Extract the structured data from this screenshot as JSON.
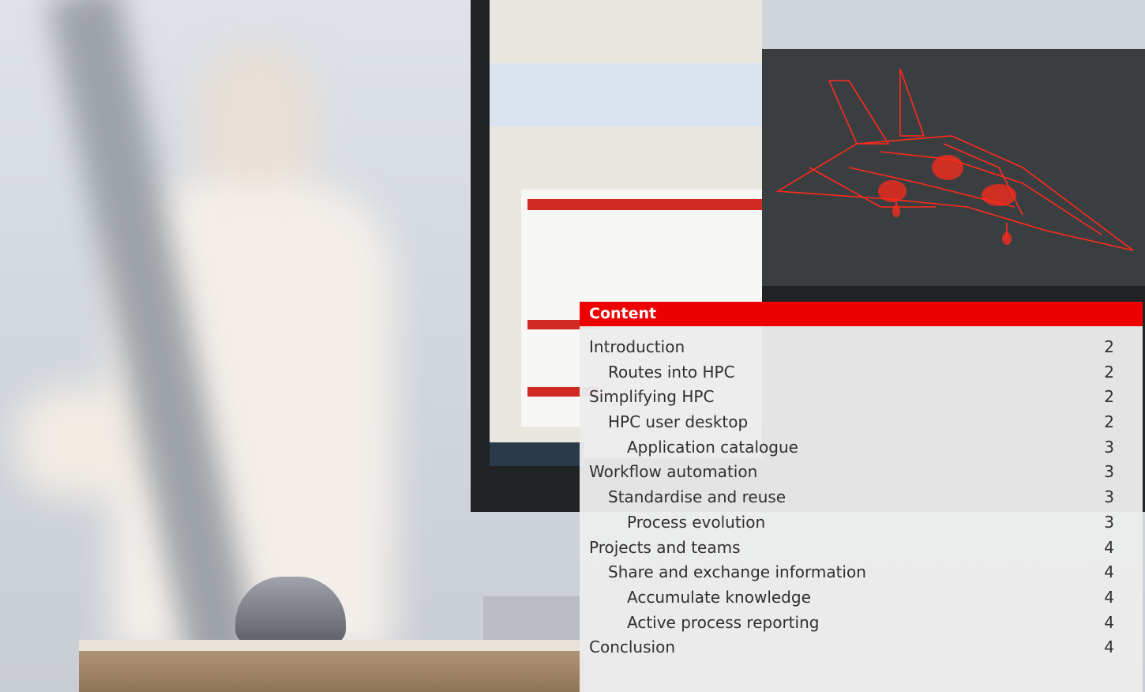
{
  "contents": {
    "heading": "Content",
    "entries": [
      {
        "label": "Introduction",
        "page": "2"
      },
      {
        "label": "Routes into HPC",
        "page": "2"
      },
      {
        "label": "Simplifying HPC",
        "page": "2"
      },
      {
        "label": "HPC user desktop",
        "page": "2"
      },
      {
        "label": "Application catalogue",
        "page": "3"
      },
      {
        "label": "Workflow automation",
        "page": "3"
      },
      {
        "label": "Standardise and reuse",
        "page": "3"
      },
      {
        "label": "Process evolution",
        "page": "3"
      },
      {
        "label": "Projects and teams",
        "page": "4"
      },
      {
        "label": "Share and exchange information",
        "page": "4"
      },
      {
        "label": "Accumulate knowledge",
        "page": "4"
      },
      {
        "label": "Active process reporting",
        "page": "4"
      },
      {
        "label": "Conclusion",
        "page": "4"
      }
    ]
  },
  "colors": {
    "accent_red": "#ee0000",
    "panel_bg": "#ececec",
    "text": "#2f2f2f",
    "wireframe": "#ff2a1a"
  }
}
